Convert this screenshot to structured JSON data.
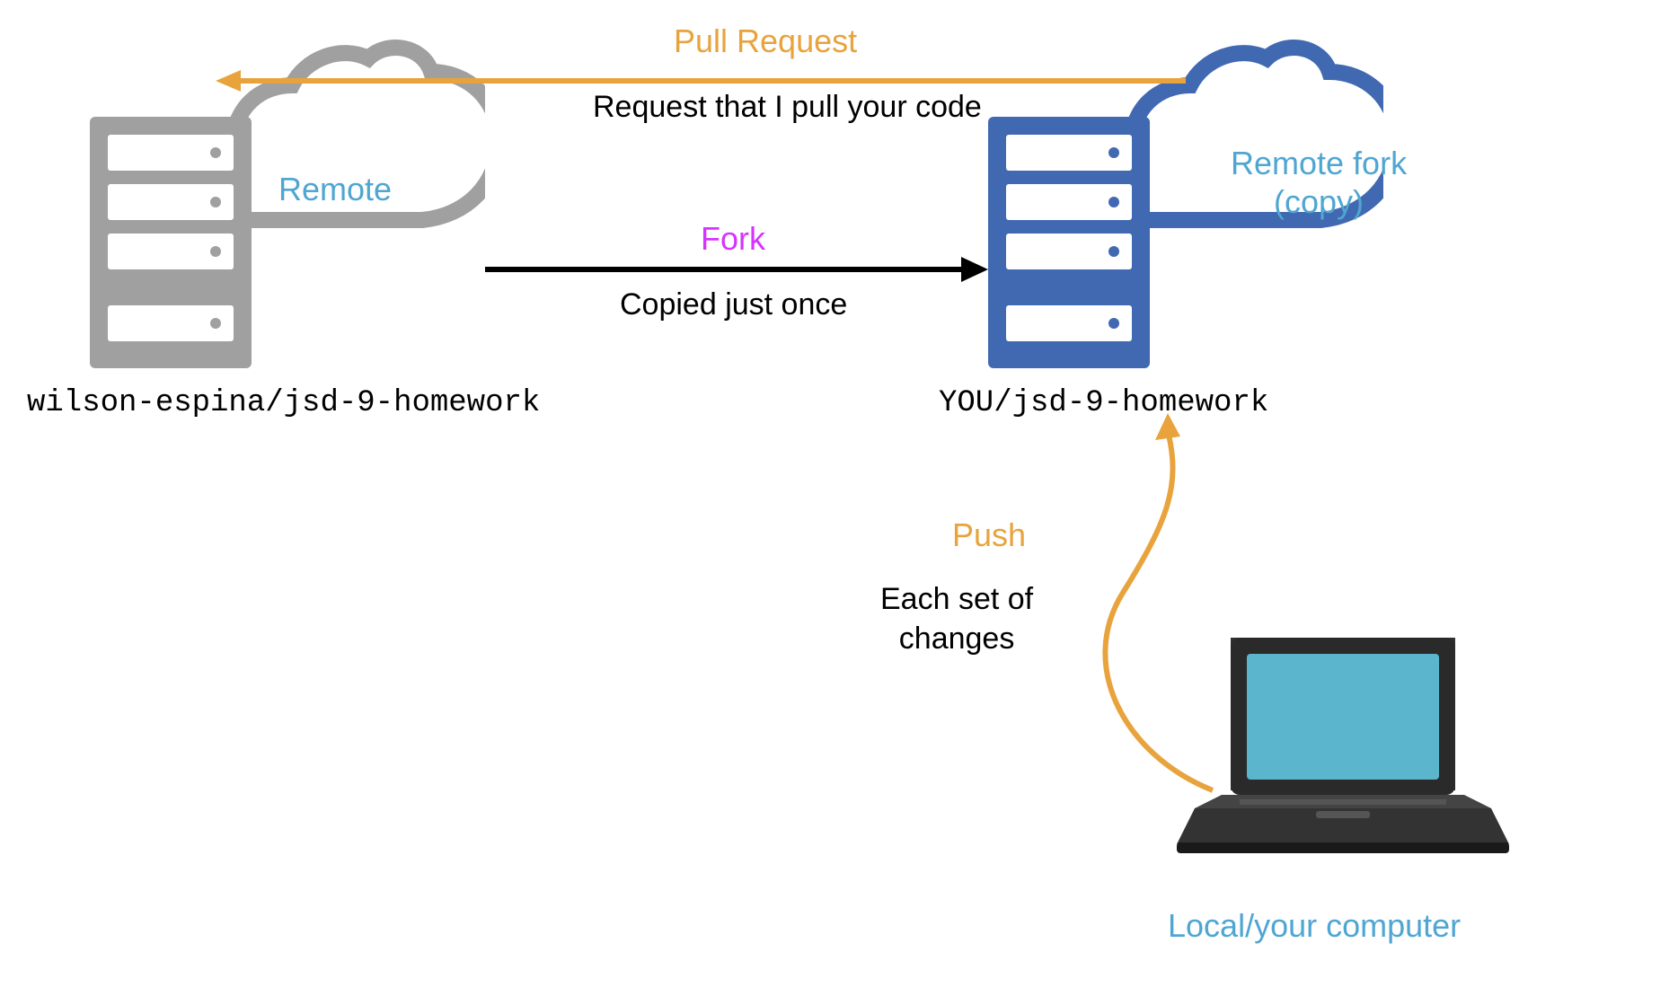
{
  "labels": {
    "remote": "Remote",
    "remoteForkLine1": "Remote fork",
    "remoteForkLine2": "(copy)",
    "localComputer": "Local/your computer",
    "originRepo": "wilson-espina/jsd-9-homework",
    "forkRepo": "YOU/jsd-9-homework",
    "pullRequest": "Pull Request",
    "pullRequestDesc": "Request that I pull your code",
    "fork": "Fork",
    "forkDesc": "Copied just once",
    "push": "Push",
    "pushDescLine1": "Each set of",
    "pushDescLine2": "changes"
  },
  "colors": {
    "gray": "#A0A0A0",
    "blue": "#4169B2",
    "lightBlue": "#4FA6D2",
    "orange": "#E8A33D",
    "magenta": "#D633FF",
    "black": "#000000",
    "laptopScreen": "#5BB5CC",
    "laptopBody": "#333333"
  }
}
